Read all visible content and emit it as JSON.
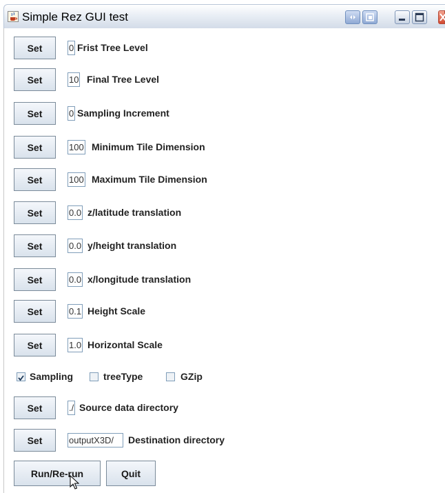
{
  "window": {
    "title": "Simple Rez GUI test",
    "app_icon": "java-cup-icon",
    "controls": [
      "extra-icon",
      "restore-icon",
      "minimize-icon",
      "maximize-icon",
      "close-icon"
    ]
  },
  "rows": [
    {
      "button": "Set",
      "value": "0",
      "label": "Frist Tree Level"
    },
    {
      "button": "Set",
      "value": "10",
      "label": "Final Tree Level"
    },
    {
      "button": "Set",
      "value": "0",
      "label": "Sampling Increment"
    },
    {
      "button": "Set",
      "value": "100",
      "label": "Minimum Tile Dimension"
    },
    {
      "button": "Set",
      "value": "100",
      "label": "Maximum Tile Dimension"
    },
    {
      "button": "Set",
      "value": "0.0",
      "label": "z/latitude translation"
    },
    {
      "button": "Set",
      "value": "0.0",
      "label": "y/height translation"
    },
    {
      "button": "Set",
      "value": "0.0",
      "label": "x/longitude translation"
    },
    {
      "button": "Set",
      "value": "0.1",
      "label": "Height Scale"
    },
    {
      "button": "Set",
      "value": "1.0",
      "label": "Horizontal Scale"
    }
  ],
  "checkboxes": [
    {
      "label": "Sampling",
      "checked": true
    },
    {
      "label": "treeType",
      "checked": false
    },
    {
      "label": "GZip",
      "checked": false
    }
  ],
  "dir_rows": [
    {
      "button": "Set",
      "value": "./",
      "label": "Source data directory"
    },
    {
      "button": "Set",
      "value": "outputX3D/",
      "label": "Destination directory"
    }
  ],
  "actions": {
    "run": "Run/Re-run",
    "quit": "Quit"
  }
}
